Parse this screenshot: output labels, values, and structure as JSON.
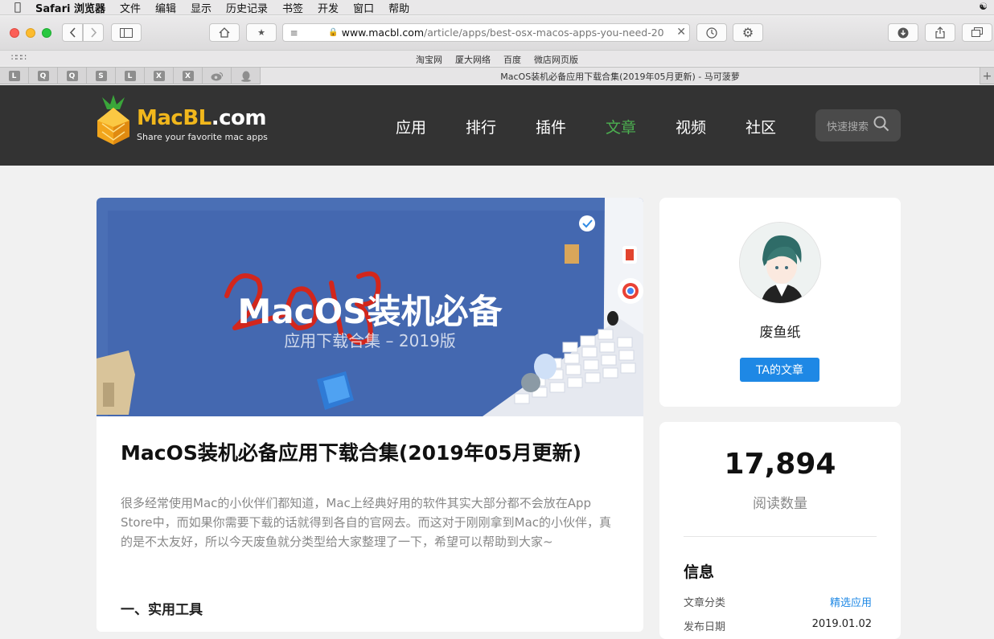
{
  "menubar": {
    "app": "Safari 浏览器",
    "items": [
      "文件",
      "编辑",
      "显示",
      "历史记录",
      "书签",
      "开发",
      "窗口",
      "帮助"
    ]
  },
  "toolbar": {
    "url_host": "www.macbl.com",
    "url_path": "/article/apps/best-osx-macos-apps-you-need-20"
  },
  "favorites": [
    "淘宝网",
    "厦大网络",
    "百度",
    "微店网页版"
  ],
  "tabs": {
    "pinned": [
      "L",
      "Q",
      "Q",
      "S",
      "L",
      "X",
      "X",
      "weibo",
      "qq"
    ],
    "active_title": "MacOS装机必备应用下载合集(2019年05月更新) - 马可菠萝"
  },
  "site": {
    "logo_main": "MacBL",
    "logo_domain": ".com",
    "logo_tagline": "Share your favorite mac apps",
    "nav": [
      "应用",
      "排行",
      "插件",
      "文章",
      "视频",
      "社区"
    ],
    "active_nav": "文章",
    "search_placeholder": "快速搜索",
    "accent": "#4caf50"
  },
  "article": {
    "hero_title": "MacOS装机必备",
    "hero_overlay": "2019",
    "hero_subtitle": "应用下载合集 – 2019版",
    "title": "MacOS装机必备应用下载合集(2019年05月更新)",
    "intro": "很多经常使用Mac的小伙伴们都知道，Mac上经典好用的软件其实大部分都不会放在App Store中，而如果你需要下载的话就得到各自的官网去。而这对于刚刚拿到Mac的小伙伴，真的是不太友好，所以今天废鱼就分类型给大家整理了一下，希望可以帮助到大家~",
    "section1": "一、实用工具"
  },
  "author": {
    "name": "废鱼纸",
    "button": "TA的文章"
  },
  "stats": {
    "views": "17,894",
    "views_label": "阅读数量",
    "info_title": "信息",
    "rows": [
      {
        "label": "文章分类",
        "value": "精选应用"
      },
      {
        "label": "发布日期",
        "value": "2019.01.02"
      }
    ]
  }
}
